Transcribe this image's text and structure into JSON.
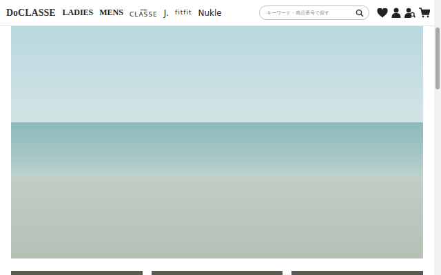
{
  "header": {
    "logo": "DoCLASSE",
    "nav": [
      {
        "label": "LADIES"
      },
      {
        "label": "MENS"
      }
    ],
    "brands": [
      {
        "kind": "stacked",
        "top": "THE",
        "label": "CLASSE"
      },
      {
        "kind": "plain",
        "label": "J."
      },
      {
        "kind": "stacked",
        "top": "",
        "label": "fitfit"
      },
      {
        "kind": "plain",
        "label": "Nukle"
      }
    ]
  },
  "search": {
    "placeholder": "キーワード・商品番号で探す"
  }
}
